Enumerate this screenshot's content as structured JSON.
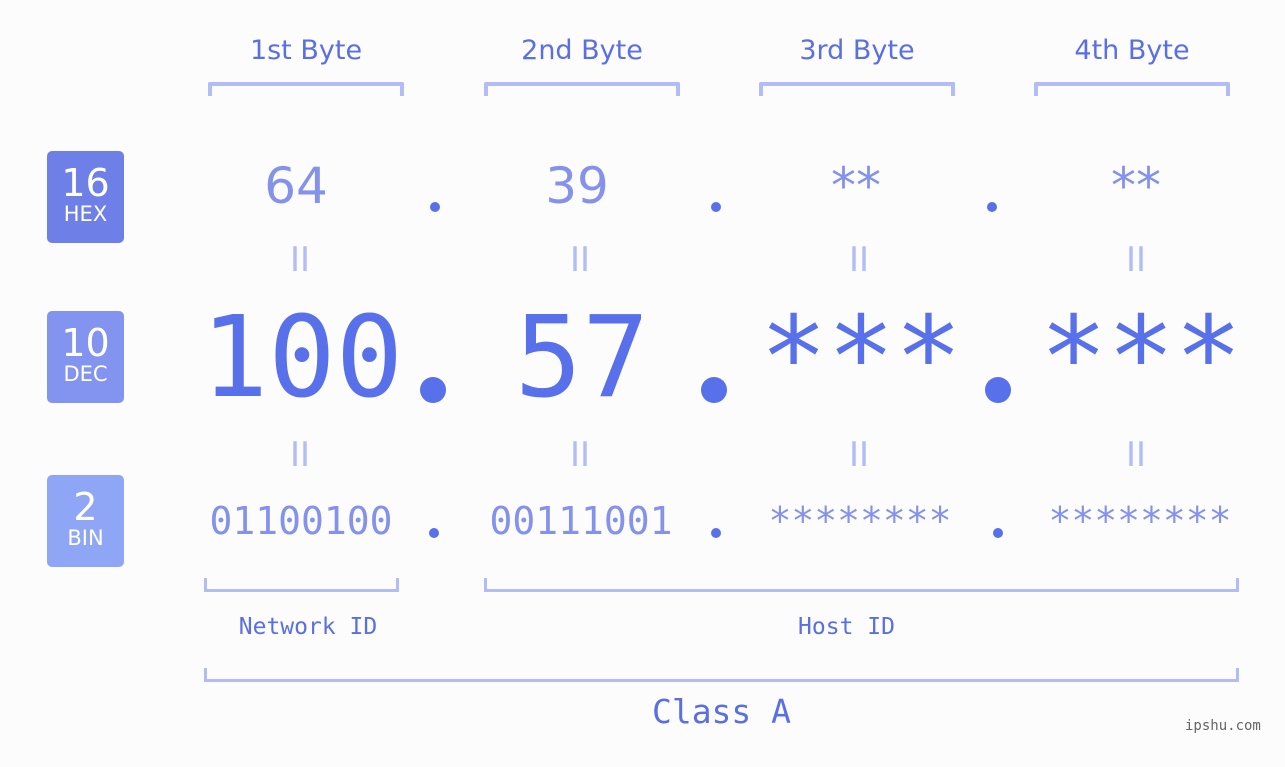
{
  "bytes": {
    "headers": [
      "1st Byte",
      "2nd Byte",
      "3rd Byte",
      "4th Byte"
    ]
  },
  "badges": {
    "hex": {
      "num": "16",
      "label": "HEX",
      "color": "#6e7fe8"
    },
    "dec": {
      "num": "10",
      "label": "DEC",
      "color": "#8394f0"
    },
    "bin": {
      "num": "2",
      "label": "BIN",
      "color": "#8fa6f7"
    }
  },
  "rows": {
    "hex": [
      "64",
      "39",
      "**",
      "**"
    ],
    "dec": [
      "100",
      "57",
      "***",
      "***"
    ],
    "bin": [
      "01100100",
      "00111001",
      "********",
      "********"
    ]
  },
  "equals_symbol": "II",
  "labels": {
    "network_id": "Network ID",
    "host_id": "Host ID",
    "class": "Class A"
  },
  "brand": "ipshu.com",
  "colors": {
    "accent": "#5870ea",
    "light_accent": "#8492ec",
    "bracket": "#b2bcf7",
    "background": "#fbfcfb"
  }
}
